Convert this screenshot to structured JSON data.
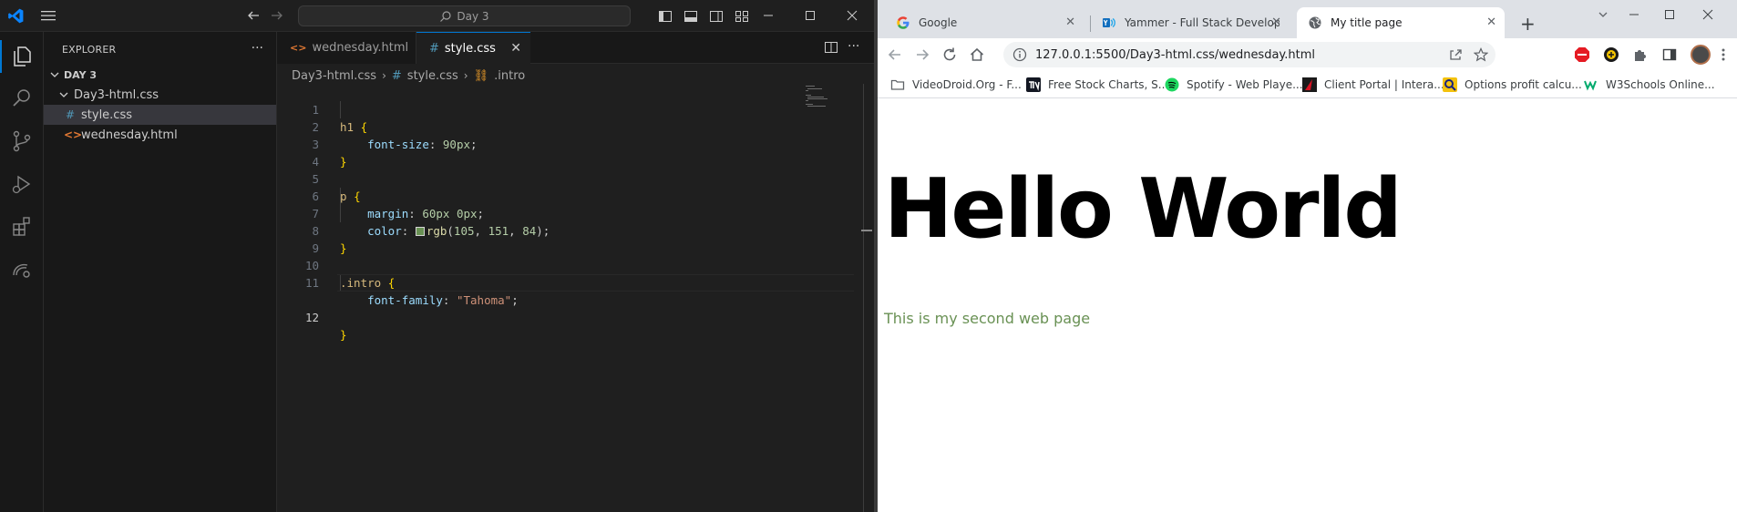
{
  "vscode": {
    "command_center": "Day 3",
    "explorer_title": "EXPLORER",
    "tree": {
      "root": "DAY 3",
      "folder": "Day3-html.css",
      "files": [
        "style.css",
        "wednesday.html"
      ]
    },
    "tabs": [
      {
        "label": "wednesday.html",
        "icon": "html-icon"
      },
      {
        "label": "style.css",
        "icon": "css-hash-icon"
      }
    ],
    "breadcrumb": [
      "Day3-html.css",
      "style.css",
      ".intro"
    ],
    "code": {
      "line_numbers": [
        "1",
        "2",
        "3",
        "4",
        "5",
        "6",
        "7",
        "8",
        "9",
        "10",
        "11",
        "12"
      ],
      "l1_sel": "h1",
      "l1_brace": "{",
      "l2_prop": "font-size",
      "l2_val": "90px",
      "l3_brace": "}",
      "l5_sel": "p",
      "l5_brace": "{",
      "l6_prop": "margin",
      "l6_val": "60px 0px",
      "l7_prop": "color",
      "l7_fn": "rgb",
      "l7_a": "105",
      "l7_b": "151",
      "l7_c": "84",
      "l8_brace": "}",
      "l10_sel": ".intro",
      "l10_brace": "{",
      "l11_prop": "font-family",
      "l11_val": "\"Tahoma\"",
      "l12_brace": "}"
    },
    "swatch_color": "#699154"
  },
  "chrome": {
    "tabs": [
      {
        "title": "Google",
        "icon": "google-icon"
      },
      {
        "title": "Yammer - Full Stack Developer",
        "icon": "yammer-icon"
      },
      {
        "title": "My title page",
        "icon": "globe-icon"
      }
    ],
    "url": "127.0.0.1:5500/Day3-html.css/wednesday.html",
    "bookmarks": [
      "VideoDroid.Org - F...",
      "Free Stock Charts, S...",
      "Spotify - Web Playe...",
      "Client Portal | Intera...",
      "Options profit calcu...",
      "W3Schools Online..."
    ],
    "page": {
      "heading": "Hello World",
      "paragraph": "This is my second web page",
      "paragraph_color": "#699154"
    }
  }
}
